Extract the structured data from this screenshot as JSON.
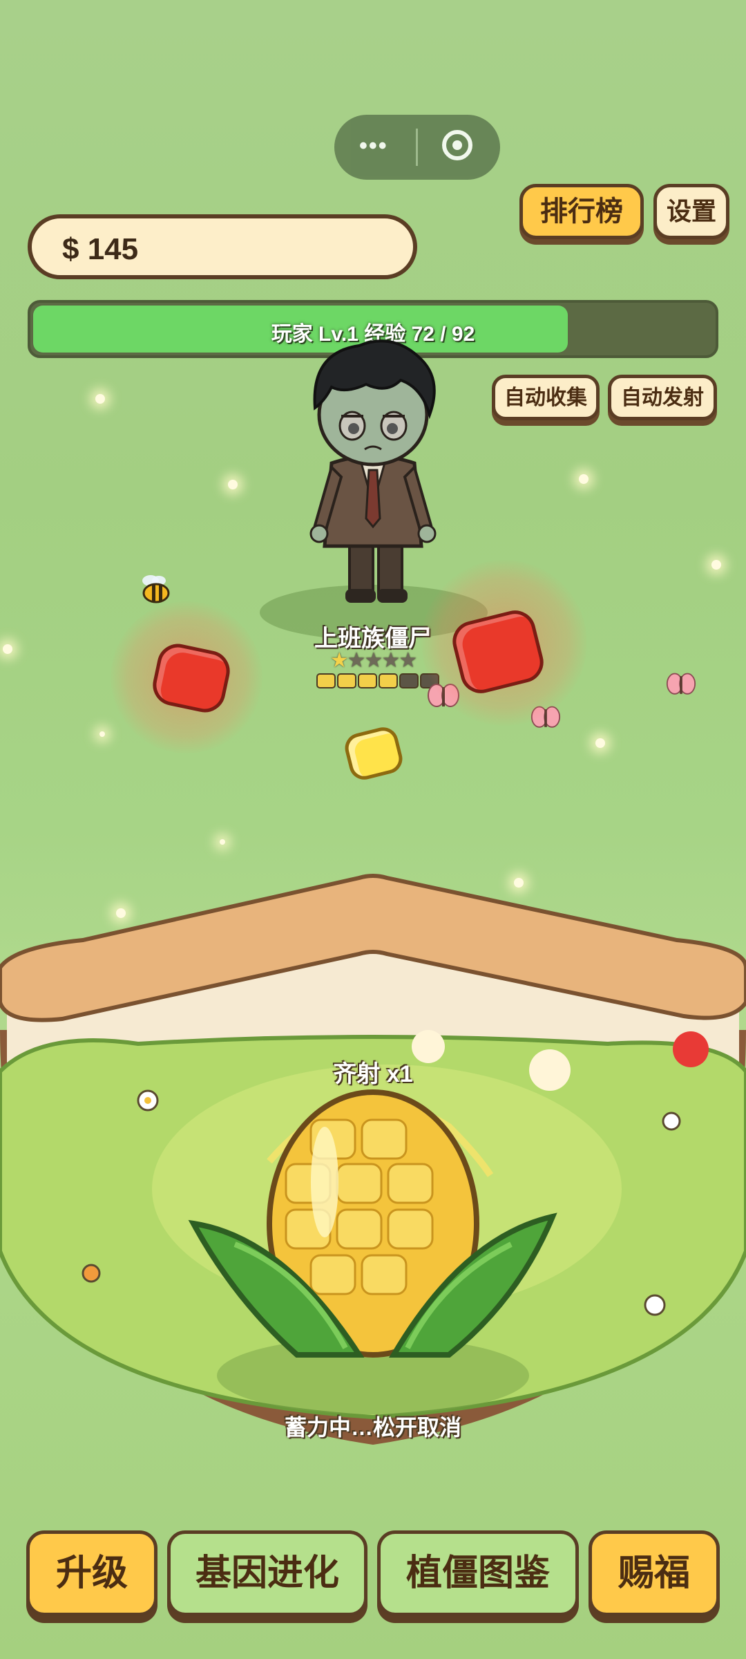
{
  "top_capsule": {
    "menu_icon": "more-dots-icon",
    "close_icon": "target-circle-icon"
  },
  "header": {
    "leaderboard_label": "排行榜",
    "settings_label": "设置",
    "money": "$ 145",
    "xp_text": "玩家 Lv.1 经验 72 / 92",
    "xp_progress": 0.78,
    "auto_collect_label": "自动收集",
    "auto_fire_label": "自动发射"
  },
  "zombie": {
    "name": "上班族僵尸",
    "stars_filled": 1,
    "stars_total": 5,
    "stars_text": "★★★★★",
    "hp_pips_filled": 4,
    "hp_pips_total": 6
  },
  "garden": {
    "shot_label": "齐射 x1",
    "status_label": "蓄力中…松开取消"
  },
  "bottom_nav": {
    "upgrade": "升级",
    "gene": "基因进化",
    "codex": "植僵图鉴",
    "bless": "赐福"
  },
  "colors": {
    "background": "#a7d486",
    "yellow_button": "#ffc94a",
    "green_button": "#b5e08c",
    "xp_fill": "#6dd765",
    "outline": "#5a3d24"
  }
}
